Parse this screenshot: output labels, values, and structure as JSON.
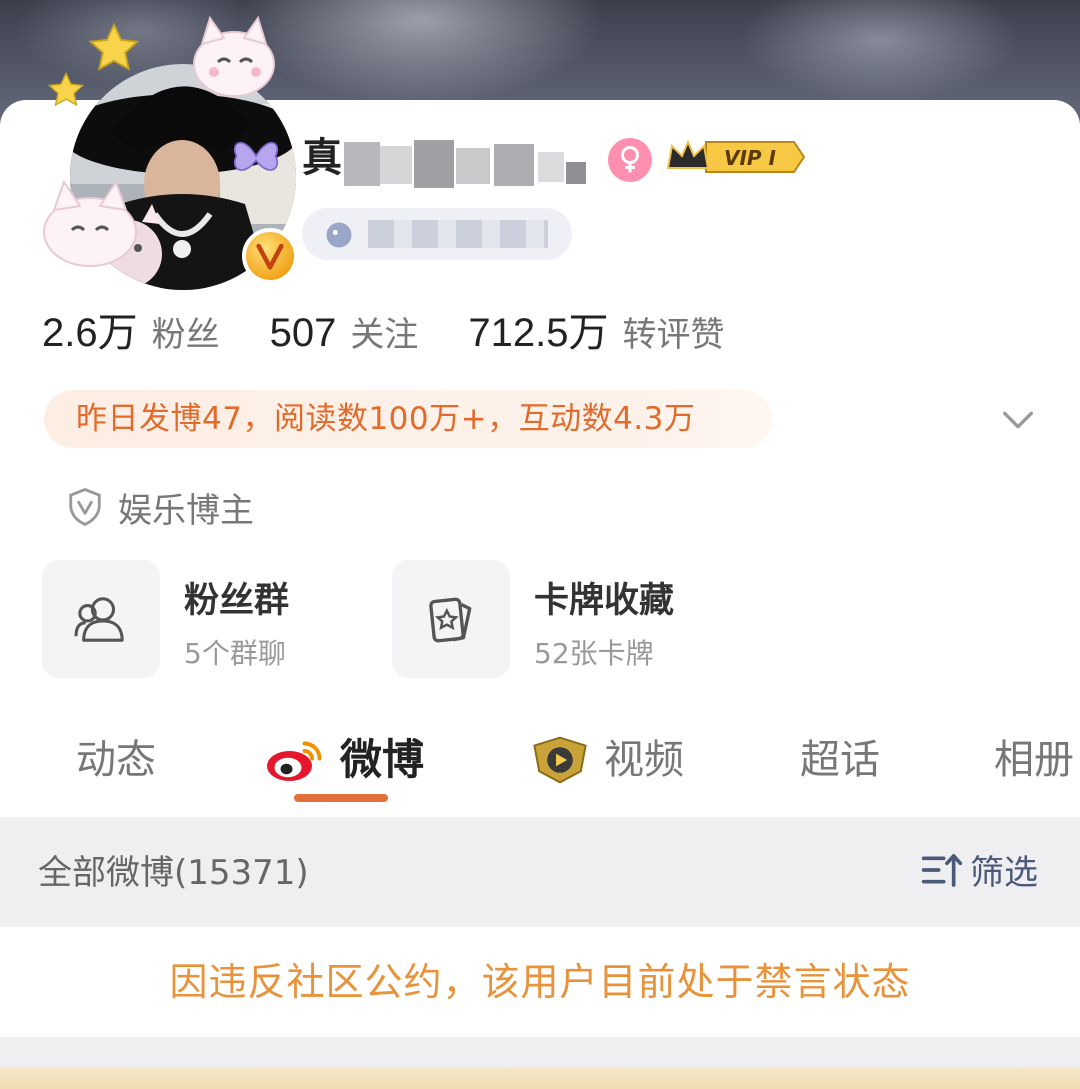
{
  "profile": {
    "name_visible": "真",
    "vip_label": "VIP I",
    "verified_badge_icon": "orange-v-icon"
  },
  "stats": [
    {
      "value": "2.6万",
      "label": "粉丝"
    },
    {
      "value": "507",
      "label": "关注"
    },
    {
      "value": "712.5万",
      "label": "转评赞"
    }
  ],
  "activity_summary": "昨日发博47，阅读数100万+，互动数4.3万",
  "verification": "娱乐博主",
  "tiles": [
    {
      "title": "粉丝群",
      "subtitle": "5个群聊",
      "icon": "group-icon"
    },
    {
      "title": "卡牌收藏",
      "subtitle": "52张卡牌",
      "icon": "card-icon"
    }
  ],
  "tabs": [
    {
      "label": "动态"
    },
    {
      "label": "微博"
    },
    {
      "label": "视频"
    },
    {
      "label": "超话"
    },
    {
      "label": "相册"
    }
  ],
  "feed": {
    "count_label": "全部微博(15371)",
    "filter_label": "筛选"
  },
  "notice": "因违反社区公约，该用户目前处于禁言状态",
  "colors": {
    "accent": "#e2703a",
    "notice": "#e8923a",
    "summary_text": "#e26a2b",
    "filter_blue": "#4a5a78"
  }
}
